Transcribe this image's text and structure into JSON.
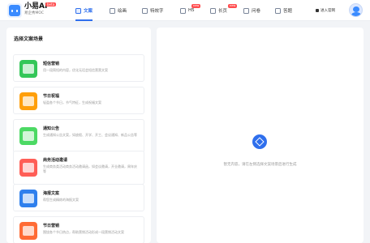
{
  "brand": {
    "title": "小易AI",
    "badge": "beta",
    "subtitle": "易企秀MOC"
  },
  "nav": [
    {
      "label": "文案",
      "icon": "document-icon",
      "active": true,
      "badge": ""
    },
    {
      "label": "绘画",
      "icon": "image-icon",
      "active": false,
      "badge": ""
    },
    {
      "label": "特效字",
      "icon": "text-effect-icon",
      "active": false,
      "badge": ""
    },
    {
      "label": "H5",
      "icon": "h5-icon",
      "active": false,
      "badge": "new"
    },
    {
      "label": "长页",
      "icon": "long-page-icon",
      "active": false,
      "badge": "new"
    },
    {
      "label": "问卷",
      "icon": "survey-icon",
      "active": false,
      "badge": ""
    },
    {
      "label": "答题",
      "icon": "quiz-icon",
      "active": false,
      "badge": ""
    }
  ],
  "header": {
    "enter_link": "进入官网"
  },
  "left": {
    "title": "选择文案场景",
    "scenes": [
      {
        "name": "短信营销",
        "desc": "用一段简短的内容，优化无话会短信营营文案",
        "color": "#34c759",
        "icon": "sms-icon"
      },
      {
        "name": "节日祝福",
        "desc": "轻盈各个节日，节气特征，生成祝福文案",
        "color": "#ff9f0a",
        "icon": "gift-icon"
      },
      {
        "name": "通知公告",
        "desc": "生成通知公告文案，如放假、开学、开工、会议通知、新品公告等",
        "color": "#4cd964",
        "icon": "notice-icon"
      },
      {
        "name": "商务活动邀请",
        "desc": "生成商务类活动商务活动邀请函，如会议邀请，开业邀请，周年庆等",
        "color": "#ff5e57",
        "icon": "invite-icon"
      },
      {
        "name": "海报文案",
        "desc": "帮您生成精炼的海报文案",
        "color": "#2f80ed",
        "icon": "poster-icon"
      },
      {
        "name": "节日营销",
        "desc": "围绕各个节日热点，帮助营销活动形成一段营销活动文案",
        "color": "#ff6b35",
        "icon": "lantern-icon"
      }
    ]
  },
  "right": {
    "empty_text": "暂无内容，请在左侧选择文案场景后进行生成",
    "icon": "cube-icon"
  },
  "colors": {
    "accent": "#2f6fed",
    "badge": "#ff4d4f"
  }
}
